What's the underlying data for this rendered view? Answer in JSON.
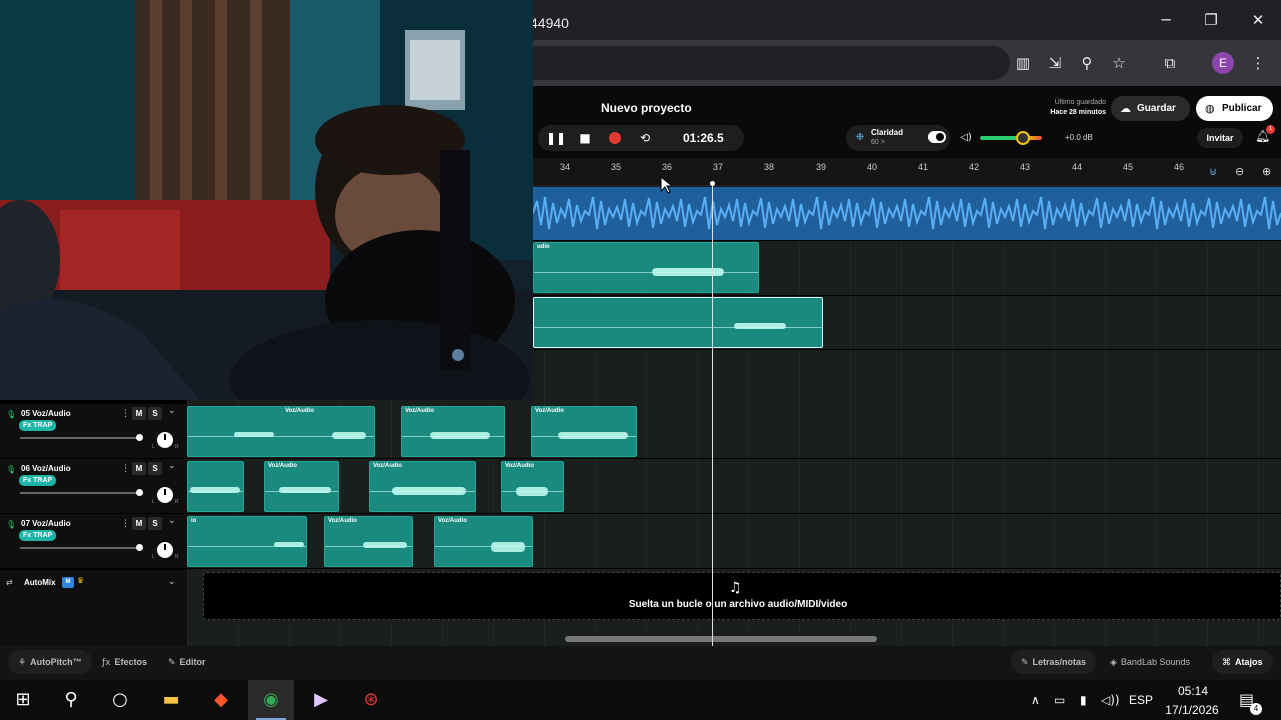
{
  "browser": {
    "url_fragment": "44940",
    "profile_initial": "E",
    "window_controls": [
      "minimize-icon",
      "restore-icon",
      "close-icon"
    ]
  },
  "header": {
    "project_title": "Nuevo proyecto",
    "time": "01:26.5",
    "claridad_label": "Claridad",
    "claridad_value": "60 >",
    "volume_db": "+0.0 dB",
    "last_saved_label": "Último guardado",
    "last_saved_value": "Hace 28 minutos",
    "save_label": "Guardar",
    "publish_label": "Publicar",
    "invite_label": "Invitar",
    "notifications_count": "1"
  },
  "ruler": {
    "bars": [
      "34",
      "35",
      "36",
      "37",
      "38",
      "39",
      "40",
      "41",
      "42",
      "43",
      "44",
      "45",
      "46"
    ]
  },
  "tracks": [
    {
      "name": "05  Voz/Audio",
      "tag": "Fx TRAP",
      "m": "M",
      "s": "S",
      "l": "L",
      "r": "R"
    },
    {
      "name": "06  Voz/Audio",
      "tag": "Fx TRAP",
      "m": "M",
      "s": "S",
      "l": "L",
      "r": "R"
    },
    {
      "name": "07  Voz/Audio",
      "tag": "Fx TRAP",
      "m": "M",
      "s": "S",
      "l": "L",
      "r": "R"
    }
  ],
  "clip_label": "Voz/Audio",
  "clip_label_partial": "udio",
  "clip_label_partial2": "io",
  "automix": {
    "label": "AutoMix",
    "badge": "M"
  },
  "drop_zone": {
    "text": "Suelta un bucle o un archivo audio/MIDI/video"
  },
  "bottom_bar": {
    "autopitch": "AutoPitch™",
    "effects": "Efectos",
    "editor": "Editor",
    "lyrics": "Letras/notas",
    "sounds": "BandLab Sounds",
    "shortcuts": "Atajos"
  },
  "taskbar": {
    "lang": "ESP",
    "time": "05:14",
    "date": "17/1/2026",
    "notifications": "4"
  },
  "colors": {
    "clip": "#1a8a7e",
    "blue_region": "#1e5f9c",
    "fx_tag": "#1db5a8",
    "record": "#e53935"
  }
}
